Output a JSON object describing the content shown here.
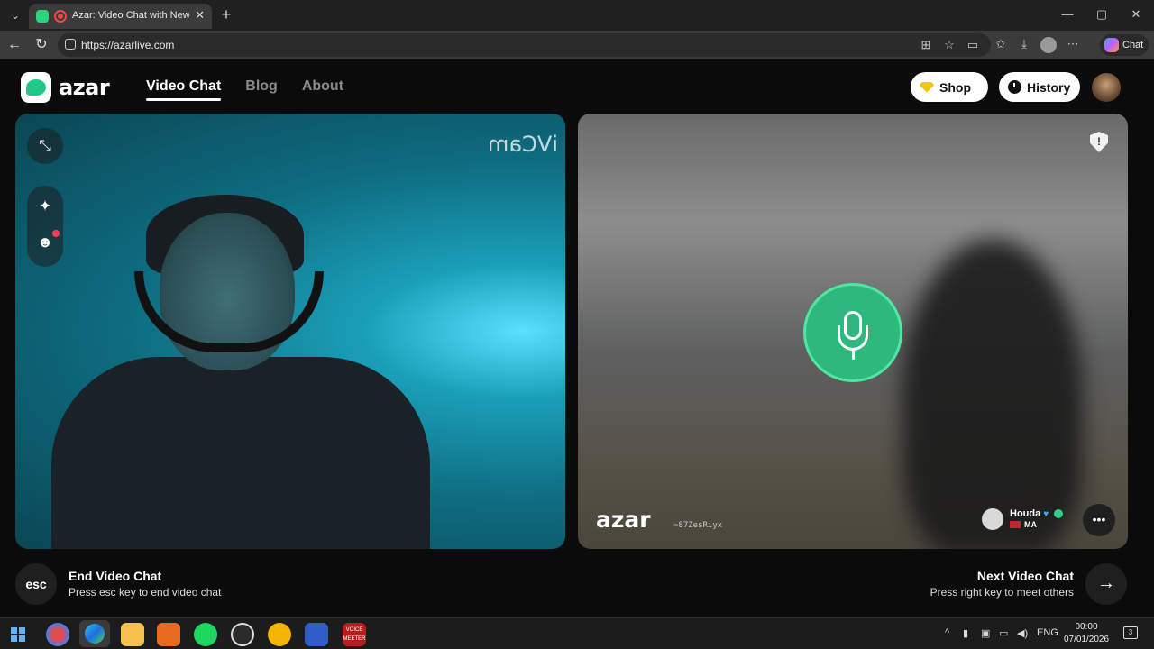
{
  "browser": {
    "tab_title": "Azar: Video Chat with New Pe",
    "url": "https://azarlive.com",
    "chat_label": "Chat"
  },
  "site": {
    "logo_text": "azar",
    "nav": [
      {
        "label": "Video Chat",
        "active": true
      },
      {
        "label": "Blog",
        "active": false
      },
      {
        "label": "About",
        "active": false
      }
    ],
    "shop_label": "Shop",
    "history_label": "History"
  },
  "self_panel": {
    "watermark": "iVCam"
  },
  "peer_panel": {
    "watermark": "azar",
    "session_id": "~87ZesRiyx",
    "peer_name": "Houda",
    "peer_country": "MA",
    "safety_icon_text": "!"
  },
  "footer": {
    "esc_key": "esc",
    "end_title": "End Video Chat",
    "end_subtitle": "Press esc key to end video chat",
    "next_title": "Next Video Chat",
    "next_subtitle": "Press right key to meet others"
  },
  "taskbar": {
    "lang": "ENG",
    "time": "00:00",
    "date": "07/01/2026",
    "notification_count": "3",
    "voice_app_line1": "VOICE",
    "voice_app_line2": "MEETER"
  },
  "colors": {
    "accent_green": "#2fb87d",
    "brand_green": "#1fc98a",
    "shop_gem": "#f5c313"
  }
}
